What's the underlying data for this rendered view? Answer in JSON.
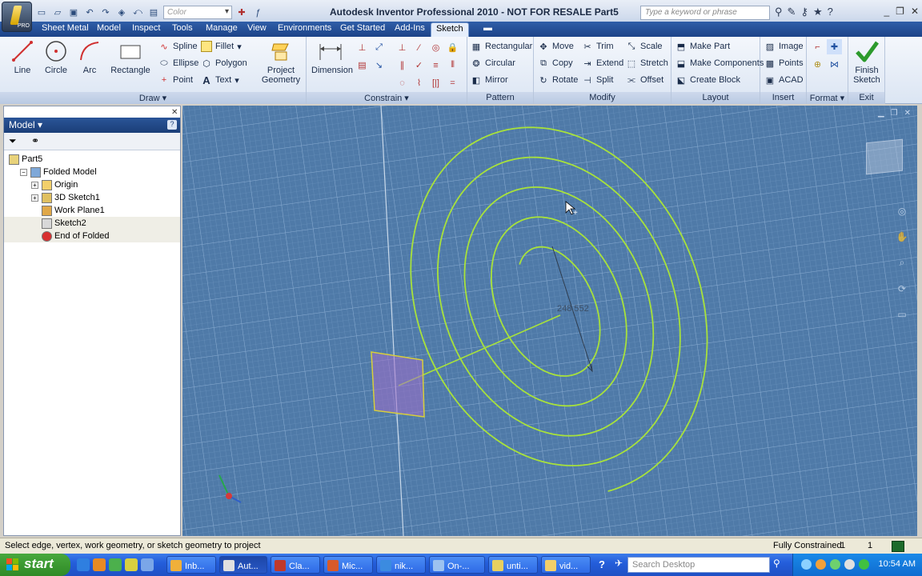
{
  "title_bar": {
    "title": "Autodesk Inventor Professional 2010 - NOT FOR RESALE   Part5",
    "color_placeholder": "Color",
    "search_placeholder": "Type a keyword or phrase",
    "app_badge": "PRO"
  },
  "menu_tabs": [
    "Sheet Metal",
    "Model",
    "Inspect",
    "Tools",
    "Manage",
    "View",
    "Environments",
    "Get Started",
    "Add-Ins",
    "Sketch"
  ],
  "active_tab": "Sketch",
  "ribbon": {
    "draw": {
      "title": "Draw",
      "line": "Line",
      "circle": "Circle",
      "arc": "Arc",
      "rectangle": "Rectangle",
      "spline": "Spline",
      "ellipse": "Ellipse",
      "point": "Point",
      "fillet": "Fillet",
      "polygon": "Polygon",
      "text": "Text",
      "project_geometry_1": "Project",
      "project_geometry_2": "Geometry"
    },
    "constrain": {
      "title": "Constrain",
      "dimension": "Dimension"
    },
    "pattern": {
      "title": "Pattern",
      "rectangular": "Rectangular",
      "circular": "Circular",
      "mirror": "Mirror"
    },
    "modify": {
      "title": "Modify",
      "move": "Move",
      "copy": "Copy",
      "rotate": "Rotate",
      "trim": "Trim",
      "extend": "Extend",
      "split": "Split",
      "scale": "Scale",
      "stretch": "Stretch",
      "offset": "Offset"
    },
    "layout": {
      "title": "Layout",
      "make_part": "Make Part",
      "make_components": "Make Components",
      "create_block": "Create Block"
    },
    "insert": {
      "title": "Insert",
      "image": "Image",
      "points": "Points",
      "acad": "ACAD"
    },
    "format": {
      "title": "Format"
    },
    "exit": {
      "title": "Exit",
      "finish_1": "Finish",
      "finish_2": "Sketch"
    }
  },
  "browser": {
    "header": "Model",
    "tree": [
      {
        "label": "Part5",
        "indent": 0,
        "expander": ""
      },
      {
        "label": "Folded Model",
        "indent": 1,
        "expander": "−"
      },
      {
        "label": "Origin",
        "indent": 2,
        "expander": "+"
      },
      {
        "label": "3D Sketch1",
        "indent": 2,
        "expander": "+"
      },
      {
        "label": "Work Plane1",
        "indent": 2,
        "expander": ""
      },
      {
        "label": "Sketch2",
        "indent": 2,
        "expander": ""
      },
      {
        "label": "End of Folded",
        "indent": 2,
        "expander": ""
      }
    ]
  },
  "canvas": {
    "dimension_label": "248.552",
    "background": "#4f7aa8",
    "sketch_color": "#a8e23a"
  },
  "status_bar": {
    "prompt": "Select edge, vertex, work geometry, or sketch geometry to project",
    "state": "Fully Constrained",
    "count_1": "1",
    "count_2": "1"
  },
  "taskbar": {
    "start": "start",
    "tasks": [
      "Inb...",
      "Aut...",
      "Cla...",
      "Mic...",
      "nik...",
      "On-...",
      "unti...",
      "vid..."
    ],
    "search_placeholder": "Search Desktop",
    "clock": "10:54 AM"
  }
}
